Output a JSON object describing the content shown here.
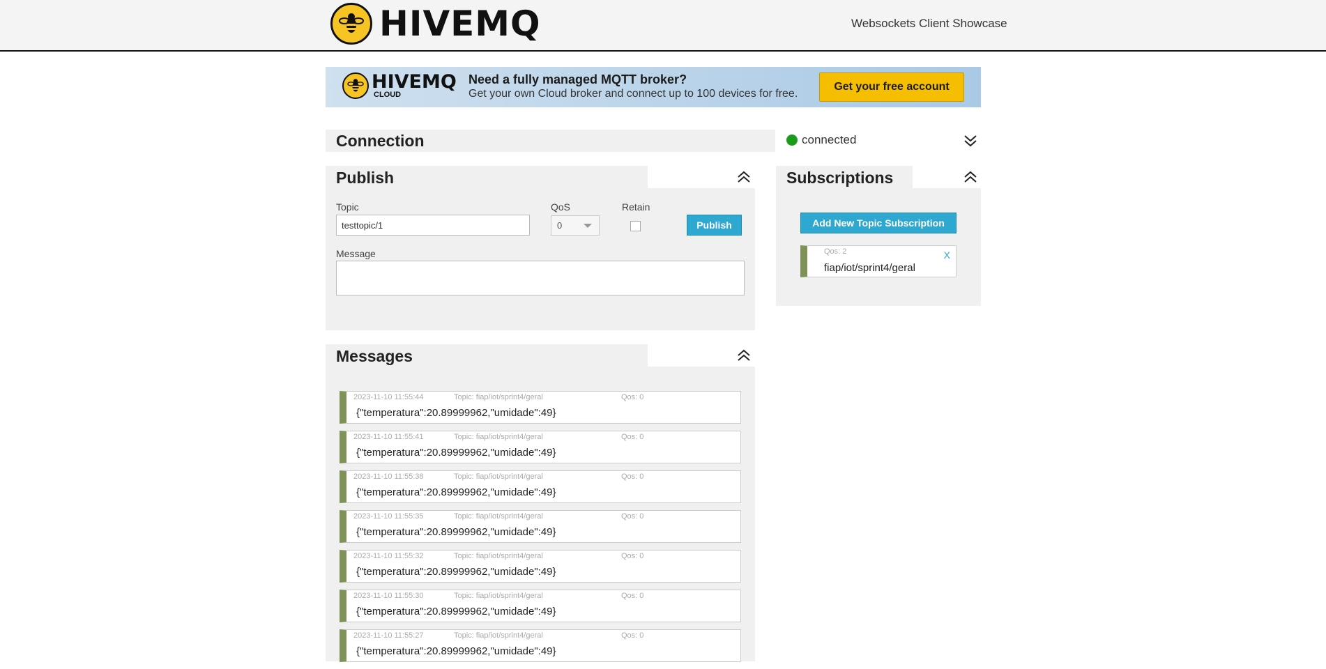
{
  "header": {
    "brand": "HIVEMQ",
    "title": "Websockets Client Showcase"
  },
  "banner": {
    "brand": "HIVEMQ",
    "brand_sub": "CLOUD",
    "headline": "Need a fully managed MQTT broker?",
    "subline": "Get your own Cloud broker and connect up to 100 devices for free.",
    "cta": "Get your free account"
  },
  "connection": {
    "title": "Connection",
    "status": "connected",
    "status_color": "#1a9c1a"
  },
  "publish": {
    "title": "Publish",
    "topic_label": "Topic",
    "topic_value": "testtopic/1",
    "qos_label": "QoS",
    "qos_value": "0",
    "retain_label": "Retain",
    "button": "Publish",
    "message_label": "Message",
    "message_value": ""
  },
  "subscriptions": {
    "title": "Subscriptions",
    "add_button": "Add New Topic Subscription",
    "items": [
      {
        "qos": "Qos: 2",
        "topic": "fiap/iot/sprint4/geral",
        "close": "X",
        "color": "#7f9358"
      }
    ]
  },
  "messages": {
    "title": "Messages",
    "items": [
      {
        "date": "2023-11-10 11:55:44",
        "topic": "Topic: fiap/iot/sprint4/geral",
        "qos": "Qos: 0",
        "payload": "{\"temperatura\":20.89999962,\"umidade\":49}"
      },
      {
        "date": "2023-11-10 11:55:41",
        "topic": "Topic: fiap/iot/sprint4/geral",
        "qos": "Qos: 0",
        "payload": "{\"temperatura\":20.89999962,\"umidade\":49}"
      },
      {
        "date": "2023-11-10 11:55:38",
        "topic": "Topic: fiap/iot/sprint4/geral",
        "qos": "Qos: 0",
        "payload": "{\"temperatura\":20.89999962,\"umidade\":49}"
      },
      {
        "date": "2023-11-10 11:55:35",
        "topic": "Topic: fiap/iot/sprint4/geral",
        "qos": "Qos: 0",
        "payload": "{\"temperatura\":20.89999962,\"umidade\":49}"
      },
      {
        "date": "2023-11-10 11:55:32",
        "topic": "Topic: fiap/iot/sprint4/geral",
        "qos": "Qos: 0",
        "payload": "{\"temperatura\":20.89999962,\"umidade\":49}"
      },
      {
        "date": "2023-11-10 11:55:30",
        "topic": "Topic: fiap/iot/sprint4/geral",
        "qos": "Qos: 0",
        "payload": "{\"temperatura\":20.89999962,\"umidade\":49}"
      },
      {
        "date": "2023-11-10 11:55:27",
        "topic": "Topic: fiap/iot/sprint4/geral",
        "qos": "Qos: 0",
        "payload": "{\"temperatura\":20.89999962,\"umidade\":49}"
      }
    ]
  }
}
